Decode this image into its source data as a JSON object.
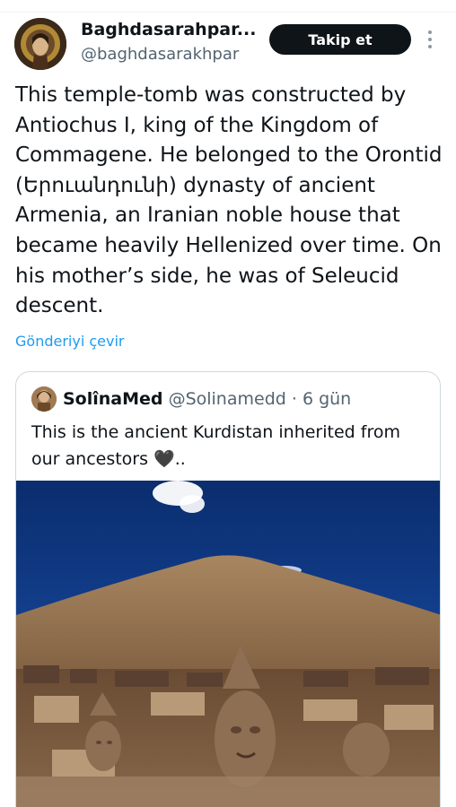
{
  "tweet": {
    "author_name": "Baghdasarahpar...",
    "author_handle": "@baghdasarakhpar",
    "follow_label": "Takip et",
    "text": "This temple-tomb was constructed by Antiochus I, king of the Kingdom of Commagene. He belonged to the Orontid (Երուանդունի) dynasty of ancient Armenia, an Iranian noble house that became heavily Hellenized over time. On his mother’s side, he was of Seleucid descent.",
    "translate_label": "Gönderiyi çevir"
  },
  "quote": {
    "name": "SolînaMed",
    "handle": "@Solinamedd",
    "separator": " · ",
    "time": "6 gün",
    "text": "This is the ancient Kurdistan inherited from our ancestors 🖤.."
  },
  "colors": {
    "text": "#0f1419",
    "secondary": "#536471",
    "link": "#1d9bf0",
    "button_bg": "#0f1419",
    "border": "#cfd9de"
  },
  "icons": {
    "more": "more-vertical-icon"
  }
}
